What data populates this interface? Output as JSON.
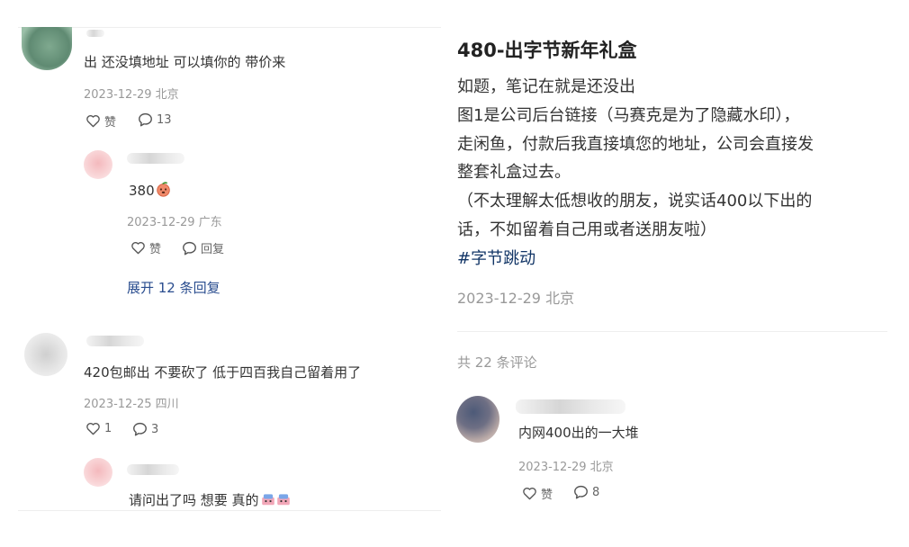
{
  "left": {
    "comments": [
      {
        "text": "出 还没填地址 可以填你的 带价来",
        "meta": "2023-12-29 北京",
        "like_label": "赞",
        "reply_count": "13",
        "reply": {
          "text": "380",
          "meta": "2023-12-29 广东",
          "like_label": "赞",
          "reply_label": "回复"
        },
        "expand_label": "展开 12 条回复"
      },
      {
        "text": "420包邮出 不要砍了 低于四百我自己留着用了",
        "meta": "2023-12-25 四川",
        "like_count": "1",
        "reply_count": "3",
        "reply": {
          "text": "请问出了吗 想要 真的"
        }
      }
    ]
  },
  "post": {
    "title": "480-出字节新年礼盒",
    "lines": [
      "如题，笔记在就是还没出",
      "图1是公司后台链接（马赛克是为了隐藏水印），",
      "走闲鱼，付款后我直接填您的地址，公司会直接发",
      "整套礼盒过去。",
      "（不太理解太低想收的朋友，说实话400以下出的",
      "话，不如留着自己用或者送朋友啦）"
    ],
    "tag": "#字节跳动",
    "meta": "2023-12-29 北京",
    "comment_count_label": "共 22 条评论"
  },
  "right_comment": {
    "text": "内网400出的一大堆",
    "meta": "2023-12-29 北京",
    "like_label": "赞",
    "reply_count": "8"
  },
  "colors": {
    "link": "#2a4d8f",
    "tag": "#133667",
    "meta": "#999999"
  }
}
